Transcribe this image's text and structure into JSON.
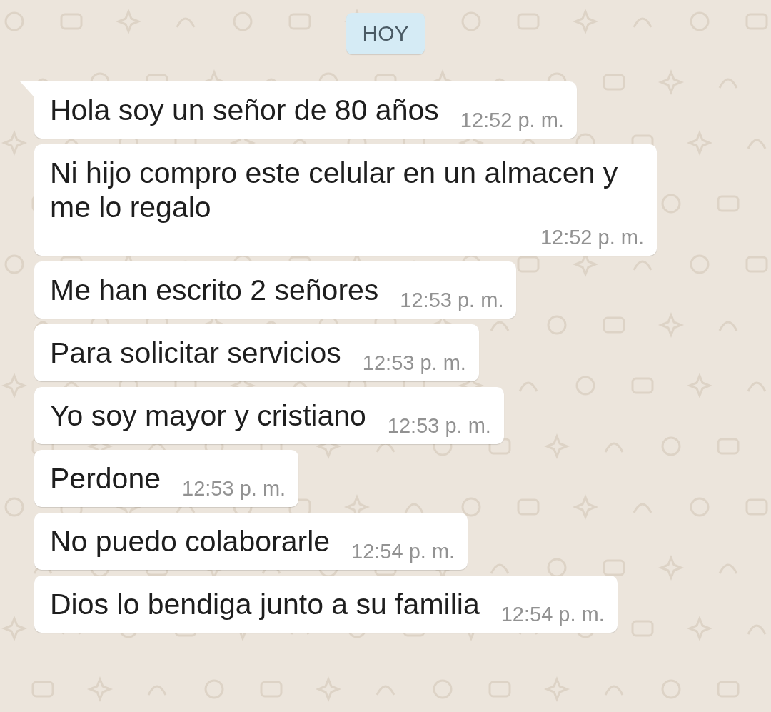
{
  "date_chip": "HOY",
  "messages": [
    {
      "text": "Hola soy un señor de 80 años",
      "time": "12:52 p. m."
    },
    {
      "text": "Ni hijo compro este celular en un almacen y me lo regalo",
      "time": "12:52 p. m."
    },
    {
      "text": "Me han escrito 2 señores",
      "time": "12:53 p. m."
    },
    {
      "text": "Para solicitar servicios",
      "time": "12:53 p. m."
    },
    {
      "text": "Yo soy mayor y cristiano",
      "time": "12:53 p. m."
    },
    {
      "text": "Perdone",
      "time": "12:53 p. m."
    },
    {
      "text": "No puedo colaborarle",
      "time": "12:54 p. m."
    },
    {
      "text": "Dios lo bendiga junto a su familia",
      "time": "12:54 p. m."
    }
  ]
}
